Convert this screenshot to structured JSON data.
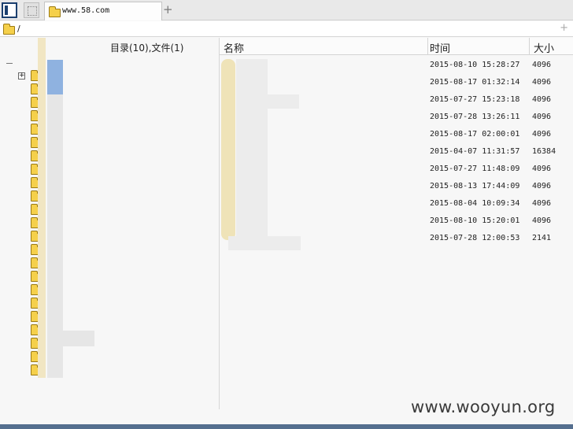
{
  "tab": {
    "label": "www.58.com"
  },
  "new_tab_label": "+",
  "path": {
    "text": "/",
    "add_label": "+"
  },
  "tree": {
    "header": "目录(10),文件(1)",
    "folder_count": 23,
    "expander_label": "+"
  },
  "columns": {
    "name": "名称",
    "time": "时间",
    "size": "大小"
  },
  "files": [
    {
      "time": "2015-08-10 15:28:27",
      "size": "4096"
    },
    {
      "time": "2015-08-17 01:32:14",
      "size": "4096"
    },
    {
      "time": "2015-07-27 15:23:18",
      "size": "4096"
    },
    {
      "time": "2015-07-28 13:26:11",
      "size": "4096"
    },
    {
      "time": "2015-08-17 02:00:01",
      "size": "4096"
    },
    {
      "time": "2015-04-07 11:31:57",
      "size": "16384"
    },
    {
      "time": "2015-07-27 11:48:09",
      "size": "4096"
    },
    {
      "time": "2015-08-13 17:44:09",
      "size": "4096"
    },
    {
      "time": "2015-08-04 10:09:34",
      "size": "4096"
    },
    {
      "time": "2015-08-10 15:20:01",
      "size": "4096"
    },
    {
      "time": "2015-07-28 12:00:53",
      "size": "2141"
    }
  ],
  "watermark": "www.wooyun.org",
  "colors": {
    "folder": "#f5d04b",
    "statusbar": "#556f8f",
    "selection": "#efe3b8"
  }
}
